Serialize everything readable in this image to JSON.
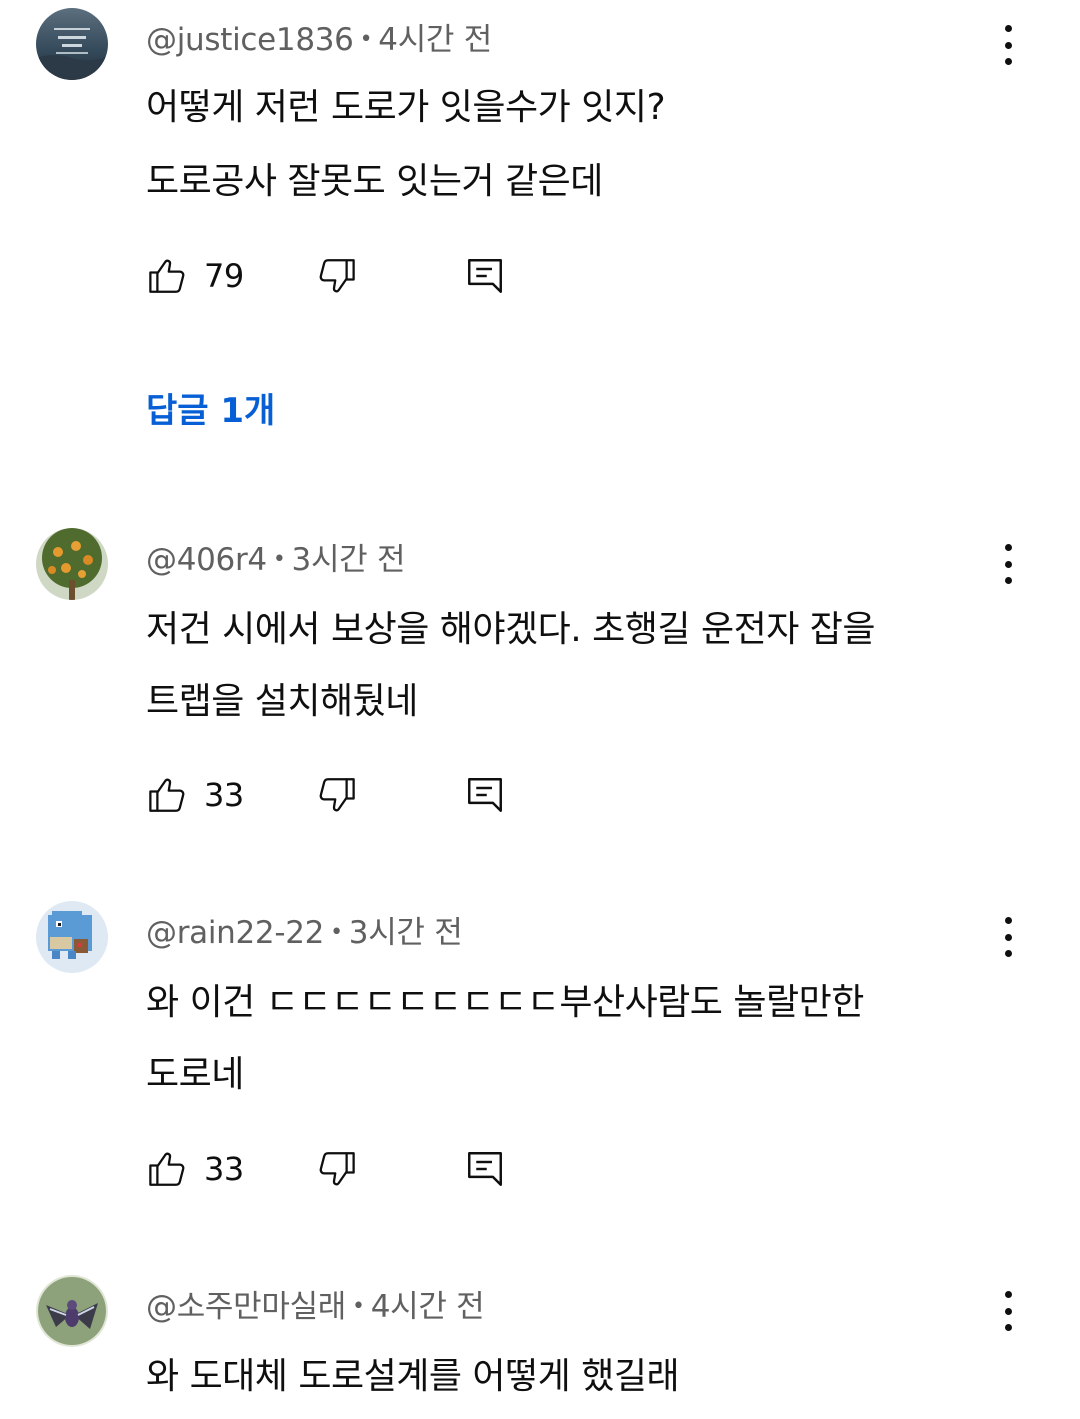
{
  "comments": [
    {
      "author": "@justice1836",
      "time": "4시간 전",
      "lines": [
        "어떻게 저런 도로가 잇을수가 잇지?",
        "도로공사 잘못도 잇는거 같은데"
      ],
      "likes": "79",
      "replies_label": "답글 1개"
    },
    {
      "author": "@406r4",
      "time": "3시간 전",
      "lines": [
        "저건 시에서 보상을 해야겠다. 초행길 운전자 잡을",
        "트랩을 설치해뒀네"
      ],
      "likes": "33"
    },
    {
      "author": "@rain22-22",
      "time": "3시간 전",
      "lines": [
        "와 이건 ㄷㄷㄷㄷㄷㄷㄷㄷㄷ부산사람도 놀랄만한",
        "도로네"
      ],
      "likes": "33"
    },
    {
      "author": "@소주만마실래",
      "time": "4시간 전",
      "lines": [
        "와 도대체 도로설계를 어떻게 했길래"
      ]
    }
  ],
  "meta_separator": "•",
  "icons": {
    "like": "thumb-up-icon",
    "dislike": "thumb-down-icon",
    "reply": "reply-comment-icon",
    "menu": "more-vert-icon"
  },
  "colors": {
    "text": "#0f0f0f",
    "secondary": "#606060",
    "link": "#065fd4"
  }
}
